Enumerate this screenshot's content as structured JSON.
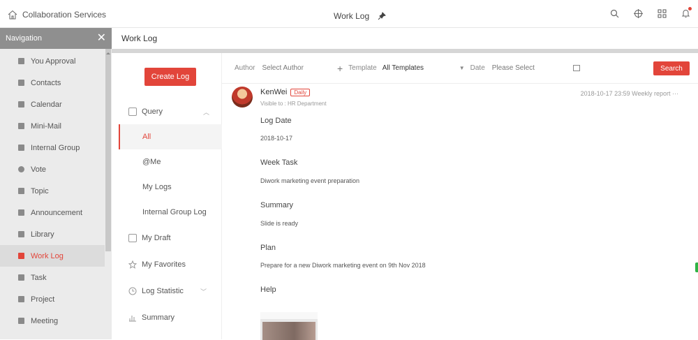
{
  "topbar": {
    "home_label": "Collaboration Services",
    "page_title": "Work Log"
  },
  "nav": {
    "header": "Navigation",
    "items": [
      {
        "label": "You Approval"
      },
      {
        "label": "Contacts"
      },
      {
        "label": "Calendar"
      },
      {
        "label": "Mini-Mail"
      },
      {
        "label": "Internal Group"
      },
      {
        "label": "Vote"
      },
      {
        "label": "Topic"
      },
      {
        "label": "Announcement"
      },
      {
        "label": "Library"
      },
      {
        "label": "Work Log"
      },
      {
        "label": "Task"
      },
      {
        "label": "Project"
      },
      {
        "label": "Meeting"
      }
    ]
  },
  "page_header": "Work Log",
  "leftcol": {
    "create_button": "Create Log",
    "query": "Query",
    "all": "All",
    "at_me": "@Me",
    "my_logs": "My Logs",
    "group_log": "Internal Group Log",
    "my_draft": "My Draft",
    "my_favorites": "My Favorites",
    "log_statistic": "Log Statistic",
    "summary": "Summary"
  },
  "filter": {
    "author_label": "Author",
    "author_placeholder": "Select Author",
    "template_label": "Template",
    "template_value": "All Templates",
    "date_label": "Date",
    "date_placeholder": "Please Select",
    "search_button": "Search"
  },
  "post": {
    "author": "KenWei",
    "badge": "Daily",
    "visible_to": "Visible to : HR Department",
    "meta": "2018-10-17 23:59  Weekly report  ···",
    "log_date_label": "Log Date",
    "log_date_value": "2018-10-17",
    "week_task_label": "Week Task",
    "week_task_value": "Diwork marketing event preparation",
    "summary_label": "Summary",
    "summary_value": "Slide is ready",
    "plan_label": "Plan",
    "plan_value": "Prepare for a new Diwork marketing event on 9th Nov 2018",
    "help_label": "Help"
  }
}
